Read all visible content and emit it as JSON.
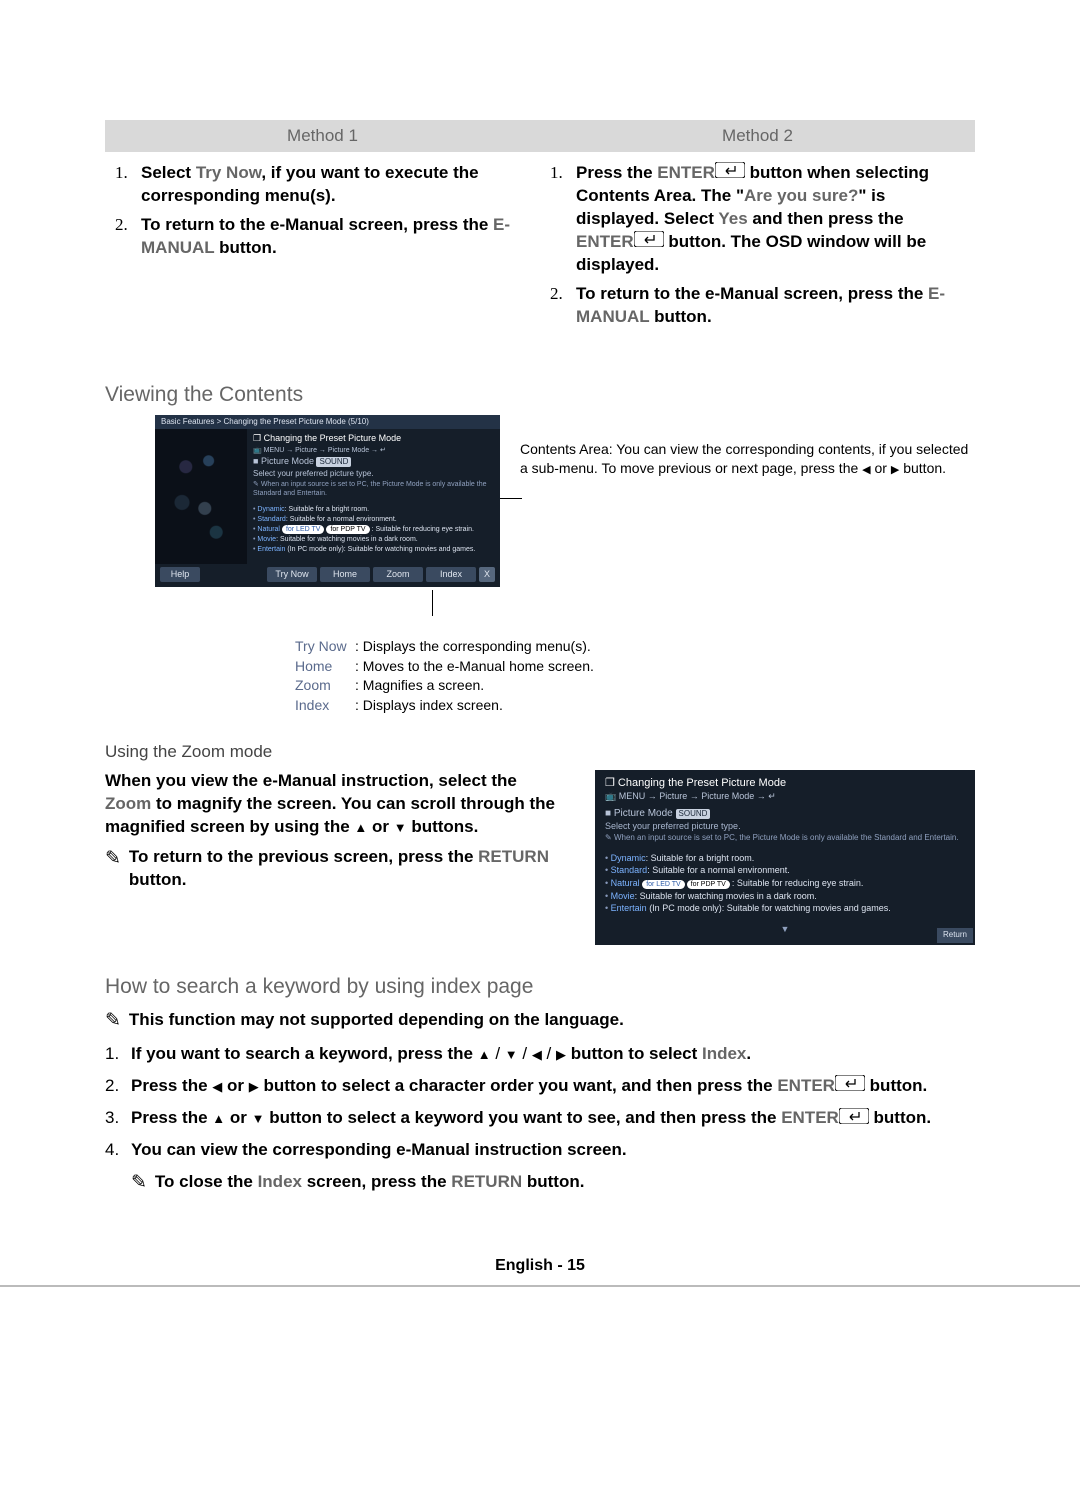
{
  "methods": {
    "left": {
      "header": "Method 1",
      "item1_a": "Select ",
      "item1_try": "Try Now",
      "item1_b": ", if you want to execute the corresponding menu(s).",
      "item2_a": "To return to the e-Manual screen, press the ",
      "item2_btn": "E-MANUAL",
      "item2_b": " button."
    },
    "right": {
      "header": "Method 2",
      "item1_a": "Press the ",
      "item1_enter": "ENTER",
      "item1_b": " button when selecting Contents Area. The \"",
      "item1_q": "Are you sure?",
      "item1_c": "\" is displayed. Select ",
      "item1_yes": "Yes",
      "item1_d": " and then press the ",
      "item1_enter2": "ENTER",
      "item1_e": " button. The OSD window will be displayed.",
      "item2_a": "To return to the e-Manual screen, press the ",
      "item2_btn": "E-MANUAL",
      "item2_b": " button."
    }
  },
  "sections": {
    "viewing_title": "Viewing the Contents",
    "zoom_title": "Using the Zoom mode",
    "search_title": "How to search a keyword by using index page"
  },
  "darkbox": {
    "crumb": "Basic Features > Changing the Preset Picture Mode (5/10)",
    "title": "Changing the Preset Picture Mode",
    "path": "MENU → Picture → Picture Mode → ",
    "picture_mode": "Picture Mode",
    "sound_tag": "SOUND",
    "select_line": "Select your preferred picture type.",
    "note": "When an input source is set to PC, the Picture Mode is only available the Standard and Entertain.",
    "bullets": {
      "b1_a": "Dynamic",
      "b1_b": ": Suitable for a bright room.",
      "b2_a": "Standard",
      "b2_b": ": Suitable for a normal environment.",
      "b3_a": "Natural",
      "b3_pill1": "for LED TV",
      "b3_pill2": "for PDP TV",
      "b3_b": ": Suitable for reducing eye strain.",
      "b4_a": "Movie",
      "b4_b": ": Suitable for watching movies in a dark room.",
      "b5_a": "Entertain",
      "b5_b": " (In PC mode only): Suitable for watching movies and games."
    },
    "toolbar": {
      "help": "Help",
      "try": "Try Now",
      "home": "Home",
      "zoom": "Zoom",
      "index": "Index",
      "x": "X"
    },
    "return": "Return"
  },
  "contents_desc": {
    "a": "Contents Area: You can view the corresponding contents, if you selected a sub-menu. To move previous or next page, press the ",
    "b": " or ",
    "c": " button."
  },
  "legend": {
    "try_l": "Try Now",
    "try_t": ": Displays the corresponding menu(s).",
    "home_l": "Home",
    "home_t": ": Moves to the e-Manual home screen.",
    "zoom_l": "Zoom",
    "zoom_t": ": Magnifies a screen.",
    "index_l": "Index",
    "index_t": ": Displays index screen."
  },
  "zoom": {
    "p1_a": "When you view the e-Manual instruction, select the ",
    "p1_z": "Zoom",
    "p1_b": " to magnify the screen. You can scroll through the magnified screen by using the ",
    "p1_c": " or ",
    "p1_d": " buttons.",
    "p2_a": "To return to the previous screen, press the ",
    "p2_btn": "RETURN",
    "p2_b": " button."
  },
  "search": {
    "s0": "This function may not supported depending on the language.",
    "s1_a": "If you want to search a keyword, press the ",
    "s1_b": " button to select ",
    "s1_idx": "Index",
    "s1_c": ".",
    "s2_a": "Press the ",
    "s2_b": " or ",
    "s2_c": " button to select a character order you want, and then press the ",
    "s2_enter": "ENTER",
    "s2_d": " button.",
    "s3_a": "Press the ",
    "s3_b": " or ",
    "s3_c": " button to select a keyword you want to see, and then press the ",
    "s3_d": " button.",
    "s4": "You can view the corresponding e-Manual instruction screen.",
    "s5_a": "To close the ",
    "s5_idx": "Index",
    "s5_b": " screen, press the ",
    "s5_btn": "RETURN",
    "s5_c": " button."
  },
  "footer": "English - 15"
}
